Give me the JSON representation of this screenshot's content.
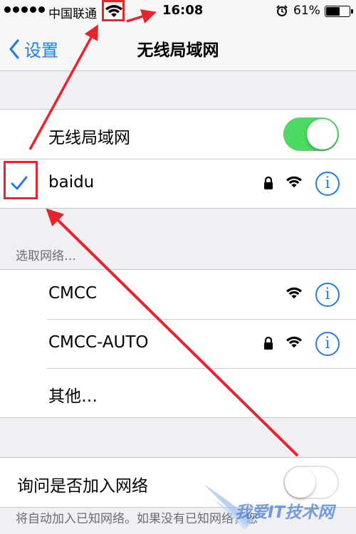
{
  "status_bar": {
    "carrier": "中国联通",
    "time": "16:08",
    "battery_percent": "61%",
    "battery_level": 0.61,
    "signal_dots": 5
  },
  "nav": {
    "back_label": "设置",
    "title": "无线局域网"
  },
  "wifi_toggle": {
    "label": "无线局域网",
    "state": "on"
  },
  "connected_network": {
    "name": "baidu",
    "secured": true,
    "selected": true
  },
  "section_header": "选取网络…",
  "networks": [
    {
      "name": "CMCC",
      "secured": false
    },
    {
      "name": "CMCC-AUTO",
      "secured": true
    }
  ],
  "other_label": "其他…",
  "ask_join": {
    "label": "询问是否加入网络",
    "state": "off"
  },
  "footer_text": "将自动加入已知网络。如果没有已知网络，您",
  "info_glyph": "i",
  "icons": [
    "wifi-icon",
    "lock-icon",
    "info-icon",
    "checkmark-icon",
    "chevron-left-icon",
    "alarm-icon",
    "battery-icon"
  ],
  "colors": {
    "accent": "#1d7cf2",
    "toggle_on": "#4cd964",
    "annotation": "#e8232a",
    "background": "#efeff4"
  },
  "watermark_text": "我爱IT技术网"
}
